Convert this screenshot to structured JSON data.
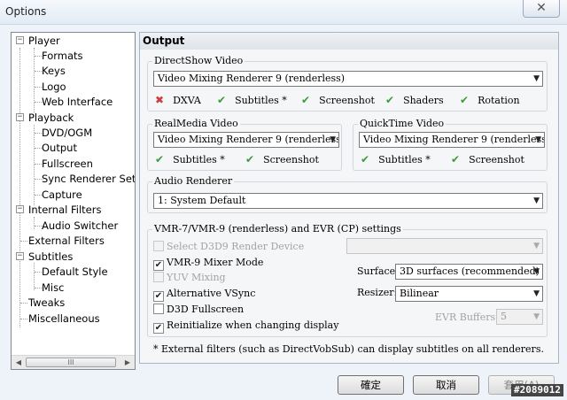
{
  "window": {
    "title": "Options",
    "close_label": "✕"
  },
  "tree": {
    "items": [
      {
        "label": "Player",
        "expander": "⊟"
      },
      {
        "label": "Formats"
      },
      {
        "label": "Keys"
      },
      {
        "label": "Logo"
      },
      {
        "label": "Web Interface"
      },
      {
        "label": "Playback",
        "expander": "⊟"
      },
      {
        "label": "DVD/OGM"
      },
      {
        "label": "Output"
      },
      {
        "label": "Fullscreen"
      },
      {
        "label": "Sync Renderer Setti"
      },
      {
        "label": "Capture"
      },
      {
        "label": "Internal Filters",
        "expander": "⊟"
      },
      {
        "label": "Audio Switcher"
      },
      {
        "label": "External Filters"
      },
      {
        "label": "Subtitles",
        "expander": "⊟"
      },
      {
        "label": "Default Style"
      },
      {
        "label": "Misc"
      },
      {
        "label": "Tweaks"
      },
      {
        "label": "Miscellaneous"
      }
    ],
    "scroll_left": "◀",
    "scroll_right": "▶",
    "thumb_grip": "III"
  },
  "panel": {
    "title": "Output",
    "directshow": {
      "label": "DirectShow Video",
      "renderer": "Video Mixing Renderer 9 (renderless)",
      "features": [
        {
          "mark": "✖",
          "label": "DXVA"
        },
        {
          "mark": "✔",
          "label": "Subtitles *"
        },
        {
          "mark": "✔",
          "label": "Screenshot"
        },
        {
          "mark": "✔",
          "label": "Shaders"
        },
        {
          "mark": "✔",
          "label": "Rotation"
        }
      ]
    },
    "realmedia": {
      "label": "RealMedia Video",
      "renderer": "Video Mixing Renderer 9 (renderless)",
      "features": [
        {
          "mark": "✔",
          "label": "Subtitles *"
        },
        {
          "mark": "✔",
          "label": "Screenshot"
        }
      ]
    },
    "quicktime": {
      "label": "QuickTime Video",
      "renderer": "Video Mixing Renderer 9 (renderless)",
      "features": [
        {
          "mark": "✔",
          "label": "Subtitles *"
        },
        {
          "mark": "✔",
          "label": "Screenshot"
        }
      ]
    },
    "audio": {
      "label": "Audio Renderer",
      "renderer": "1: System Default"
    },
    "vmr": {
      "label": "VMR-7/VMR-9 (renderless) and EVR (CP) settings",
      "options": [
        {
          "label": "Select D3D9 Render Device",
          "checked": "",
          "disabled": true
        },
        {
          "label": "VMR-9 Mixer Mode",
          "checked": "✔",
          "disabled": false
        },
        {
          "label": "YUV Mixing",
          "checked": "",
          "disabled": true
        },
        {
          "label": "Alternative VSync",
          "checked": "✔",
          "disabled": false
        },
        {
          "label": "D3D Fullscreen",
          "checked": "",
          "disabled": false
        },
        {
          "label": "Reinitialize when changing display",
          "checked": "✔",
          "disabled": false
        }
      ],
      "device_value": "",
      "surface_label": "Surface:",
      "surface_value": "3D surfaces (recommended)",
      "resizer_label": "Resizer:",
      "resizer_value": "Bilinear",
      "evr_buffers_label": "EVR Buffers:",
      "evr_buffers_value": "5"
    },
    "footnote": "* External filters (such as DirectVobSub) can display subtitles on all renderers."
  },
  "buttons": {
    "ok": "確定",
    "cancel": "取消",
    "apply": "套用(A)"
  },
  "watermark": "#2089012",
  "colors": {
    "check_green": "#3c9a3c",
    "cross_red": "#d13b3b"
  }
}
